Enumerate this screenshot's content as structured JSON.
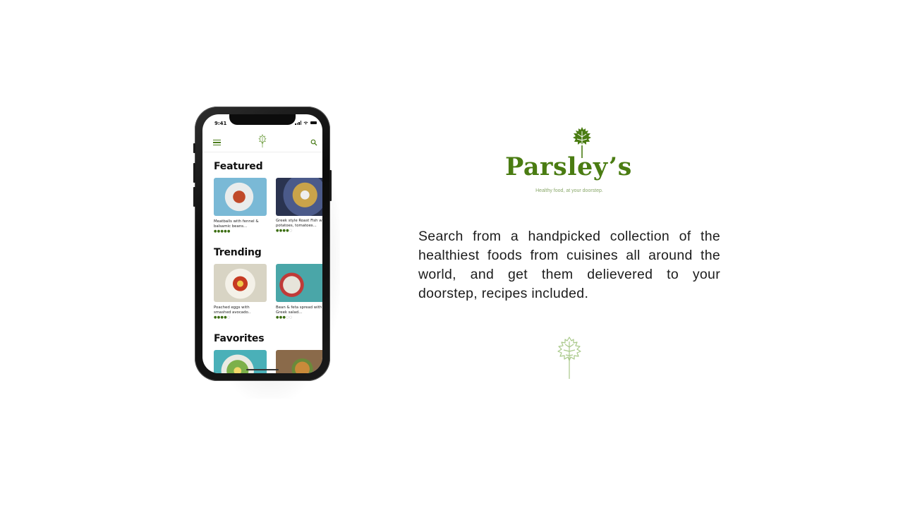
{
  "phone": {
    "status_time": "9:41",
    "header": {
      "menu_icon": "hamburger-menu-icon",
      "logo_icon": "parsley-leaf-icon",
      "search_icon": "search-icon"
    },
    "sections": [
      {
        "title": "Featured",
        "cards": [
          {
            "caption_line1": "Meatballs with fennel &",
            "caption_line2": "balsamic beans...",
            "rating": 5
          },
          {
            "caption_line1": "Greek style Roast Fish w",
            "caption_line2": "potatoes, tomatoes...",
            "rating": 4
          }
        ]
      },
      {
        "title": "Trending",
        "cards": [
          {
            "caption_line1": "Poached eggs with",
            "caption_line2": "smashed avocado..",
            "rating": 4
          },
          {
            "caption_line1": "Bean & feta spread with",
            "caption_line2": "Greek salad...",
            "rating": 3
          }
        ]
      },
      {
        "title": "Favorites",
        "cards": [
          {
            "caption_line1": "",
            "caption_line2": "",
            "rating": null
          },
          {
            "caption_line1": "",
            "caption_line2": "",
            "rating": null
          }
        ]
      }
    ]
  },
  "brand": {
    "name": "Parsley’s",
    "tagline": "Healthy food, at your doorstep.",
    "logo_icon": "parsley-leaf-icon",
    "color": "#4a7c12"
  },
  "description": "Search from a handpicked collection of the healthiest foods from cuisines all around the world, and get them delievered to your doorstep, recipes included.",
  "decoration": {
    "bottom_icon": "parsley-sprig-icon",
    "color": "#a9c98a"
  }
}
